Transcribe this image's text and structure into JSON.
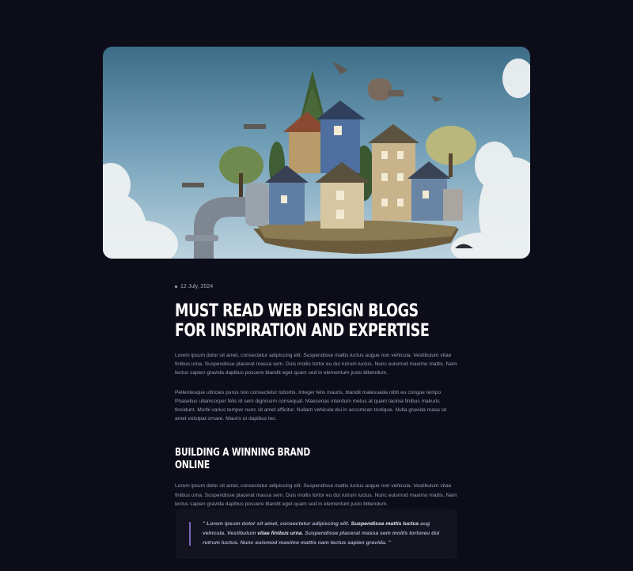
{
  "post": {
    "date": "12 July, 2024",
    "title": "Must Read Web Design Blogs for Inspiration and Expertise",
    "intro_1": "Lorem ipsum dolor sit amet, consectetur adipiscing elit. Suspendisse mattis luctus augue non vehicula. Vestibulum vitae finibus urna. Suspendisse placerat massa sem. Duis mollis tortor eu dui rutrum luctus. Nunc euismod maximu mattis. Nam lectus sapien gravida dapibus posuere blandit eget quam sed in elementum justo bibendum.",
    "intro_2": "Pellentesque ultricies purus non consectetur lobortis. Integer felis mauris, blandit malesuada nibh eu congue tempo Phasellus ullamcorper felis id sem dignissim consequat. Maecenas interdum metus at quam lacinia finibus makuris tincidunt. Morbi varius tempor nunc sit amet efficitur. Nullam vehicula dui in accumsan tristique. Nulla gravida masa sit amet volutpat ornare. Mauris ut dapibus leo.",
    "subheading": "Building a Winning Brand Online",
    "section_text": "Lorem ipsum dolor sit amet, consectetur adipiscing elit. Suspendisse mattis luctus augue non vehicula. Vestibulum vitae finibus urna. Suspendisse placerat massa sem. Duis mollis tortor eu dui rutrum luctus. Nunc euismod maximo mattis. Nam lectus sapien gravida dapibus posuere blandit eget quam sed in elementum justo bibendum.",
    "quote": {
      "part_1": "\" Lorem ipsum dolor sit amet, consectetur adipiscing elit. ",
      "part_2": "Suspendisse mattis luctus",
      "part_3": " aug vehicula. Vestibulum ",
      "part_4": "vitae finibus urna",
      "part_5": ". Suspendisse placerat massa sem mollis tortoreu dui rutrum luctus. Nunc euismod maximo mattis nam lectus sapien gravida. \""
    }
  },
  "colors": {
    "background": "#0c0d19",
    "heading": "#ffffff",
    "body_text": "#9c9eb3",
    "quote_bar": "#7a67b7",
    "quote_bg": "#13141f"
  },
  "icons": {
    "date_marker": "bullet-dot-icon"
  }
}
